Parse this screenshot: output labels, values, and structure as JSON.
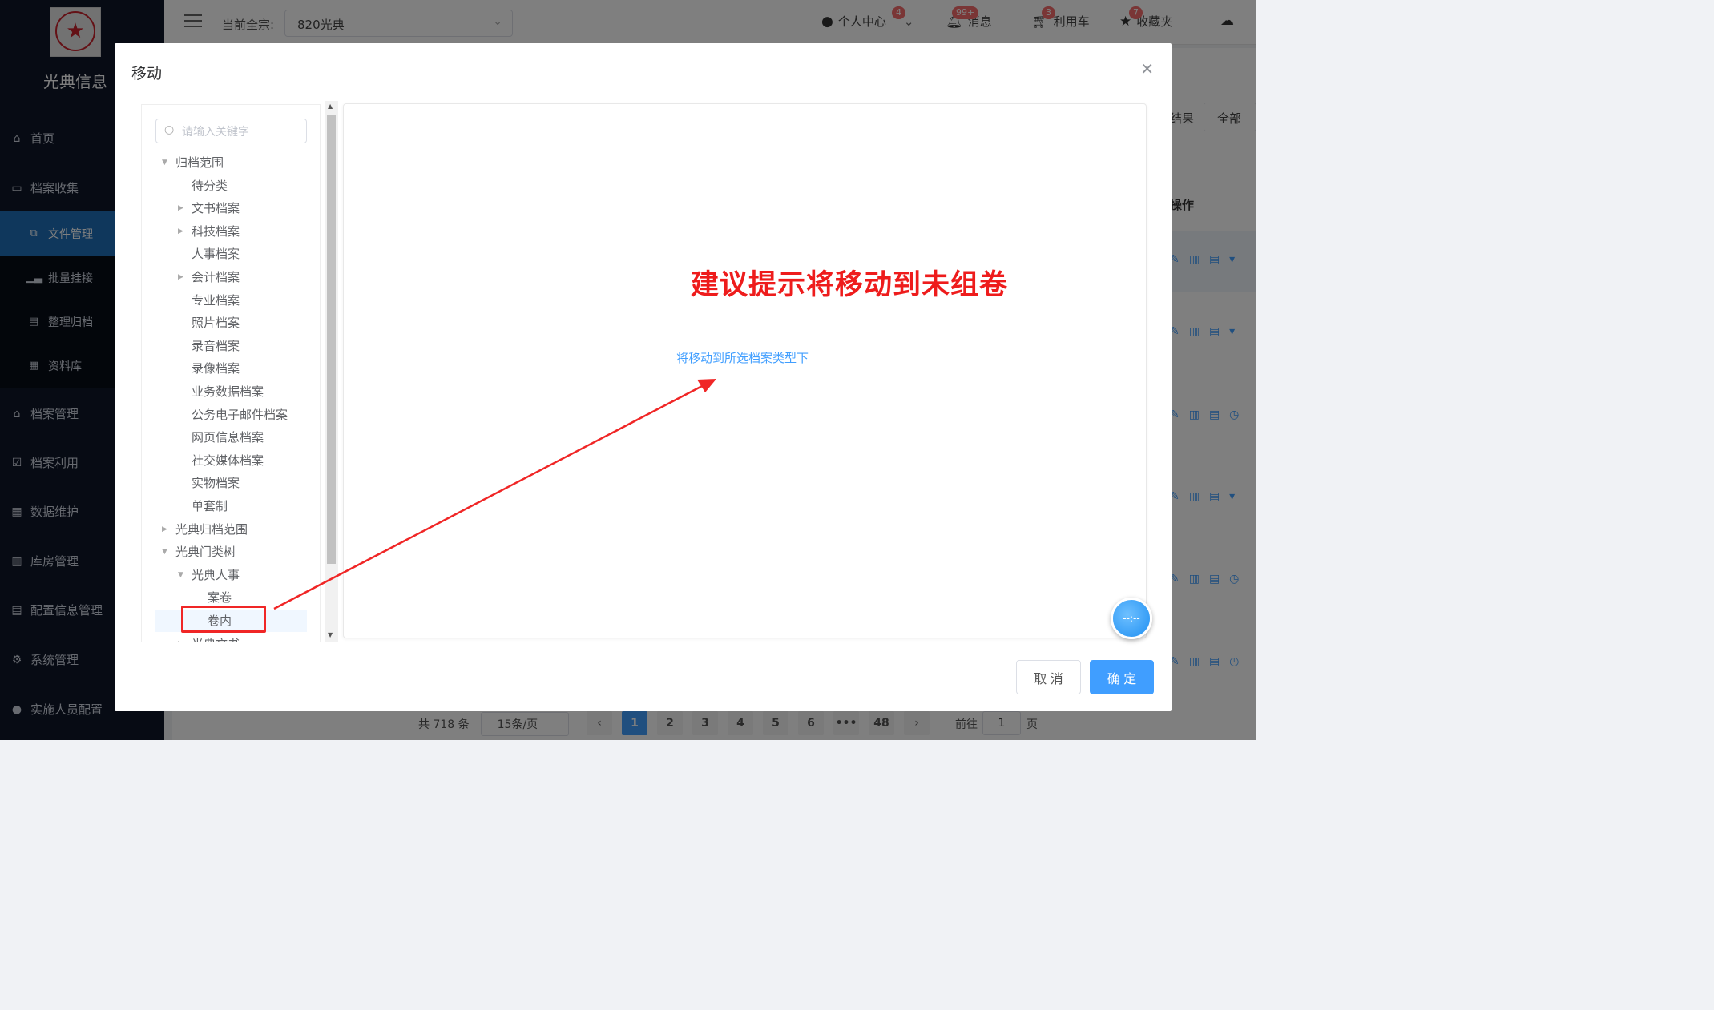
{
  "sidebar": {
    "brand": "光典信息",
    "items": [
      {
        "label": "首页",
        "icon": "home-icon"
      },
      {
        "label": "档案收集",
        "icon": "box-icon"
      },
      {
        "label": "档案管理",
        "icon": "bank-icon"
      },
      {
        "label": "档案利用",
        "icon": "clipboard-check-icon"
      },
      {
        "label": "数据维护",
        "icon": "grid-icon"
      },
      {
        "label": "库房管理",
        "icon": "building-icon"
      },
      {
        "label": "配置信息管理",
        "icon": "clipboard-icon"
      },
      {
        "label": "系统管理",
        "icon": "gear-icon"
      },
      {
        "label": "实施人员配置",
        "icon": "user-icon"
      }
    ],
    "sub_items": [
      {
        "label": "文件管理",
        "icon": "file-copy-icon"
      },
      {
        "label": "批量挂接",
        "icon": "bar-chart-icon"
      },
      {
        "label": "整理归档",
        "icon": "document-icon"
      },
      {
        "label": "资料库",
        "icon": "calendar-icon"
      }
    ]
  },
  "header": {
    "fonds_label": "当前全宗:",
    "fonds_value": "820光典",
    "personal_center": "个人中心",
    "personal_badge": "4",
    "messages": "消息",
    "messages_badge": "99+",
    "cart": "利用车",
    "cart_badge": "3",
    "favorites": "收藏夹",
    "favorites_badge": "7"
  },
  "background": {
    "results_label": "结果",
    "all_button": "全部",
    "ops_header": "操作",
    "pager_total": "共 718 条",
    "pager_size": "15条/页",
    "pages": [
      "1",
      "2",
      "3",
      "4",
      "5",
      "6",
      "•••",
      "48"
    ],
    "goto_label": "前往",
    "goto_value": "1",
    "page_unit": "页"
  },
  "dialog": {
    "title": "移动",
    "search_placeholder": "请输入关键字",
    "tree": [
      {
        "label": "归档范围",
        "level": 0,
        "expanded": true
      },
      {
        "label": "待分类",
        "level": 1
      },
      {
        "label": "文书档案",
        "level": 1,
        "collapsed": true
      },
      {
        "label": "科技档案",
        "level": 1,
        "collapsed": true
      },
      {
        "label": "人事档案",
        "level": 1
      },
      {
        "label": "会计档案",
        "level": 1,
        "collapsed": true
      },
      {
        "label": "专业档案",
        "level": 1
      },
      {
        "label": "照片档案",
        "level": 1
      },
      {
        "label": "录音档案",
        "level": 1
      },
      {
        "label": "录像档案",
        "level": 1
      },
      {
        "label": "业务数据档案",
        "level": 1
      },
      {
        "label": "公务电子邮件档案",
        "level": 1
      },
      {
        "label": "网页信息档案",
        "level": 1
      },
      {
        "label": "社交媒体档案",
        "level": 1
      },
      {
        "label": "实物档案",
        "level": 1
      },
      {
        "label": "单套制",
        "level": 1
      },
      {
        "label": "光典归档范围",
        "level": 0,
        "collapsed": true
      },
      {
        "label": "光典门类树",
        "level": 0,
        "expanded": true
      },
      {
        "label": "光典人事",
        "level": 1,
        "expanded": true
      },
      {
        "label": "案卷",
        "level": 2
      },
      {
        "label": "卷内",
        "level": 2,
        "selected": true
      },
      {
        "label": "光典文书",
        "level": 1,
        "collapsed": true
      }
    ],
    "annotation": "建议提示将移动到未组卷",
    "hint": "将移动到所选档案类型下",
    "cancel": "取 消",
    "confirm": "确 定",
    "float_button": "--:--"
  }
}
